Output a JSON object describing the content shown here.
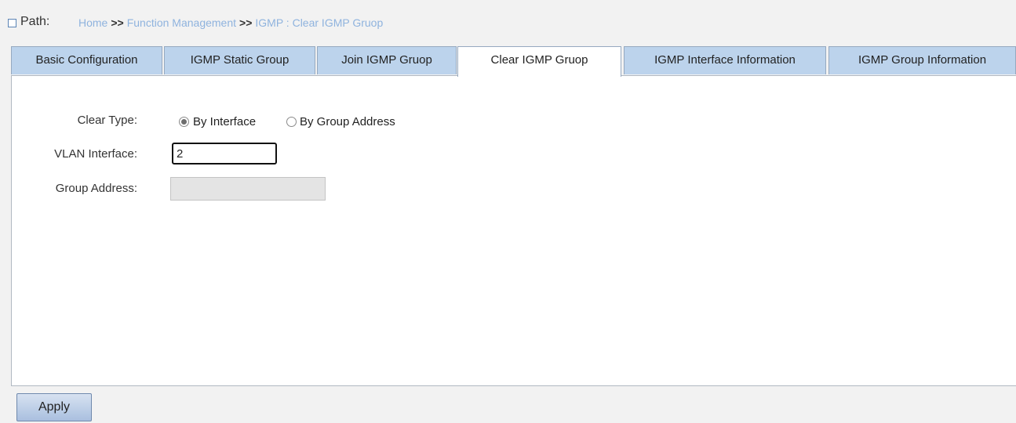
{
  "path": {
    "label": "Path:",
    "crumbs": [
      "Home",
      "Function Management",
      "IGMP : Clear IGMP Gruop"
    ],
    "separator": ">>"
  },
  "tabs": [
    {
      "label": "Basic Configuration",
      "active": false
    },
    {
      "label": "IGMP Static Group",
      "active": false
    },
    {
      "label": "Join IGMP Gruop",
      "active": false
    },
    {
      "label": "Clear IGMP Gruop",
      "active": true
    },
    {
      "label": "IGMP Interface Information",
      "active": false
    },
    {
      "label": "IGMP Group Information",
      "active": false
    }
  ],
  "form": {
    "clear_type": {
      "label": "Clear Type:",
      "options": [
        "By Interface",
        "By Group Address"
      ],
      "selected": "By Interface"
    },
    "vlan_interface": {
      "label": "VLAN Interface:",
      "value": "2"
    },
    "group_address": {
      "label": "Group Address:",
      "value": "",
      "disabled": true
    }
  },
  "apply_label": "Apply"
}
